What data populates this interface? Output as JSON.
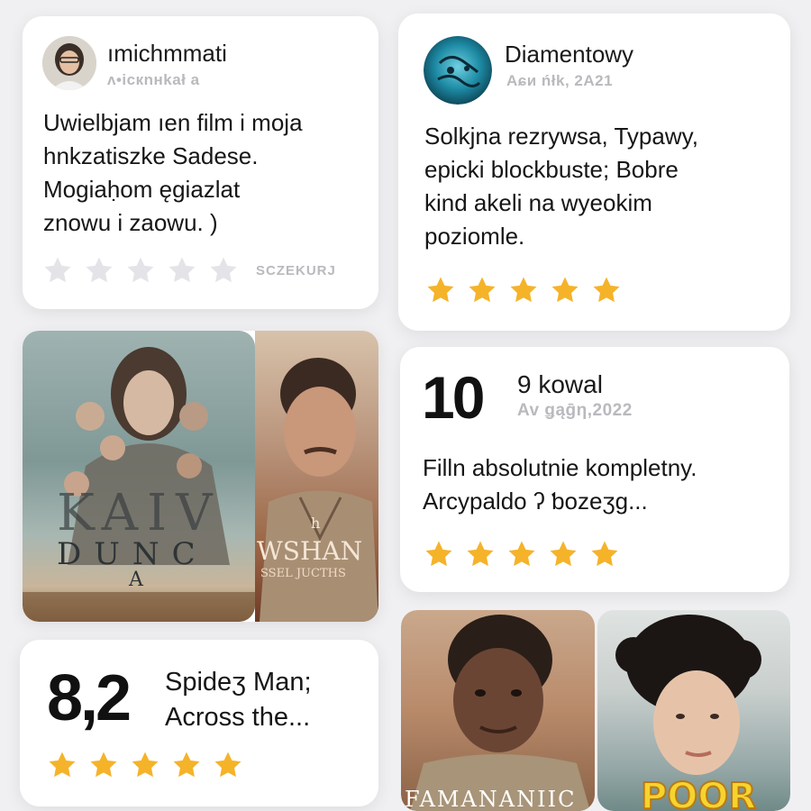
{
  "colors": {
    "background": "#f0f0f2",
    "card": "#ffffff",
    "star_filled": "#f5b32a",
    "star_empty": "#e4e4e8",
    "muted_text": "#b9b9be"
  },
  "reviews": [
    {
      "user": "ımichmmati",
      "date": "ʌ•icкnнkał a",
      "text_lines": [
        "Uwielbjam ıen film i moja",
        "hnkzatiszke Sadese.",
        "Mogiaḥom ęgiazlat",
        "znowu i zaowu. )"
      ],
      "rating": 0,
      "action": "SCZEKURJ",
      "avatar_icon": "person-avatar"
    },
    {
      "user": "Diamentowy",
      "date": "Aɕᴎ ńłk, 2A21",
      "text_lines": [
        "Solkjna rezrywsa, Typawy,",
        "epicki blockbuste;  Bobre",
        "kind akeli na wyeokim",
        "poziomle."
      ],
      "rating": 5,
      "avatar_icon": "teal-texture-avatar"
    },
    {
      "score": "10",
      "user": "9 kowal",
      "date": "Av ǥąḡη,2022",
      "text_lines": [
        "Filln absolutnie kompletny.",
        "Arcypaldo ʔ ƅozeʒg..."
      ],
      "rating": 5
    },
    {
      "score": "8,2",
      "title_lines": [
        "Spideʒ Man;",
        "Across the..."
      ],
      "rating": 5
    }
  ],
  "posters": [
    {
      "title_top": "KAIV",
      "title_bottom": "DUNC",
      "subtitle": "A"
    },
    {
      "title_small": "h",
      "title": "WSHAN",
      "subtitle": "SSEL JUCTHS"
    },
    {
      "title": "FAMANANIIC"
    },
    {
      "title": "POOR"
    }
  ]
}
